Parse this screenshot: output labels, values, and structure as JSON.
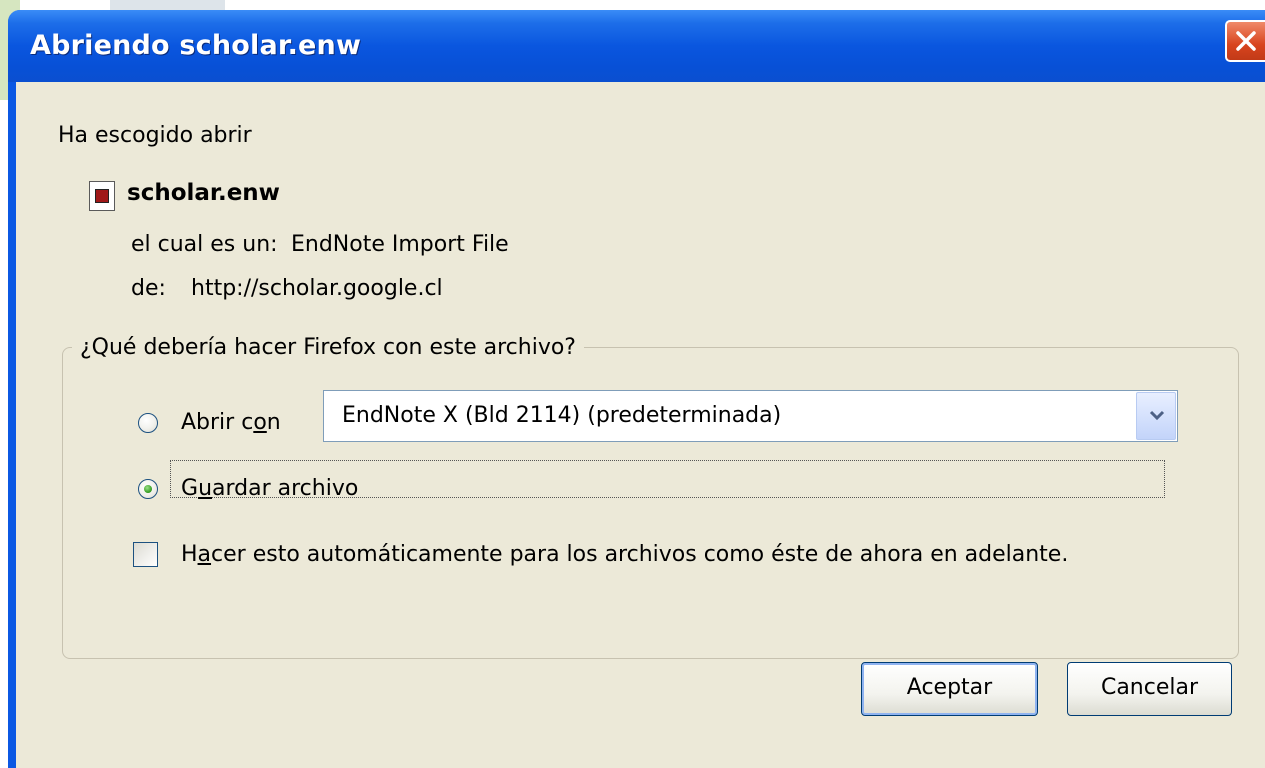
{
  "window": {
    "title": "Abriendo scholar.enw"
  },
  "intro": "Ha escogido abrir",
  "file": {
    "name": "scholar.enw",
    "type_label": "el cual es un:",
    "type_value": "EndNote Import File",
    "source_label": "de:",
    "source_value": "http://scholar.google.cl"
  },
  "action_group": {
    "legend": "¿Qué debería hacer Firefox con este archivo?",
    "open_with": {
      "label_pre": "Abrir c",
      "label_key": "o",
      "label_post": "n",
      "selected": false
    },
    "app_select": {
      "value": "EndNote X (Bld 2114) (predeterminada)"
    },
    "save_file": {
      "label_pre": "G",
      "label_key": "u",
      "label_post": "ardar archivo",
      "selected": true
    },
    "auto_checkbox": {
      "label_pre": "H",
      "label_key": "a",
      "label_post": "cer esto automáticamente para los archivos como éste de ahora en adelante.",
      "checked": false
    }
  },
  "buttons": {
    "accept": "Aceptar",
    "cancel": "Cancelar"
  },
  "colors": {
    "titlebar": "#0a56df",
    "dialog_bg": "#ece9d8",
    "close_button": "#d8441e"
  }
}
